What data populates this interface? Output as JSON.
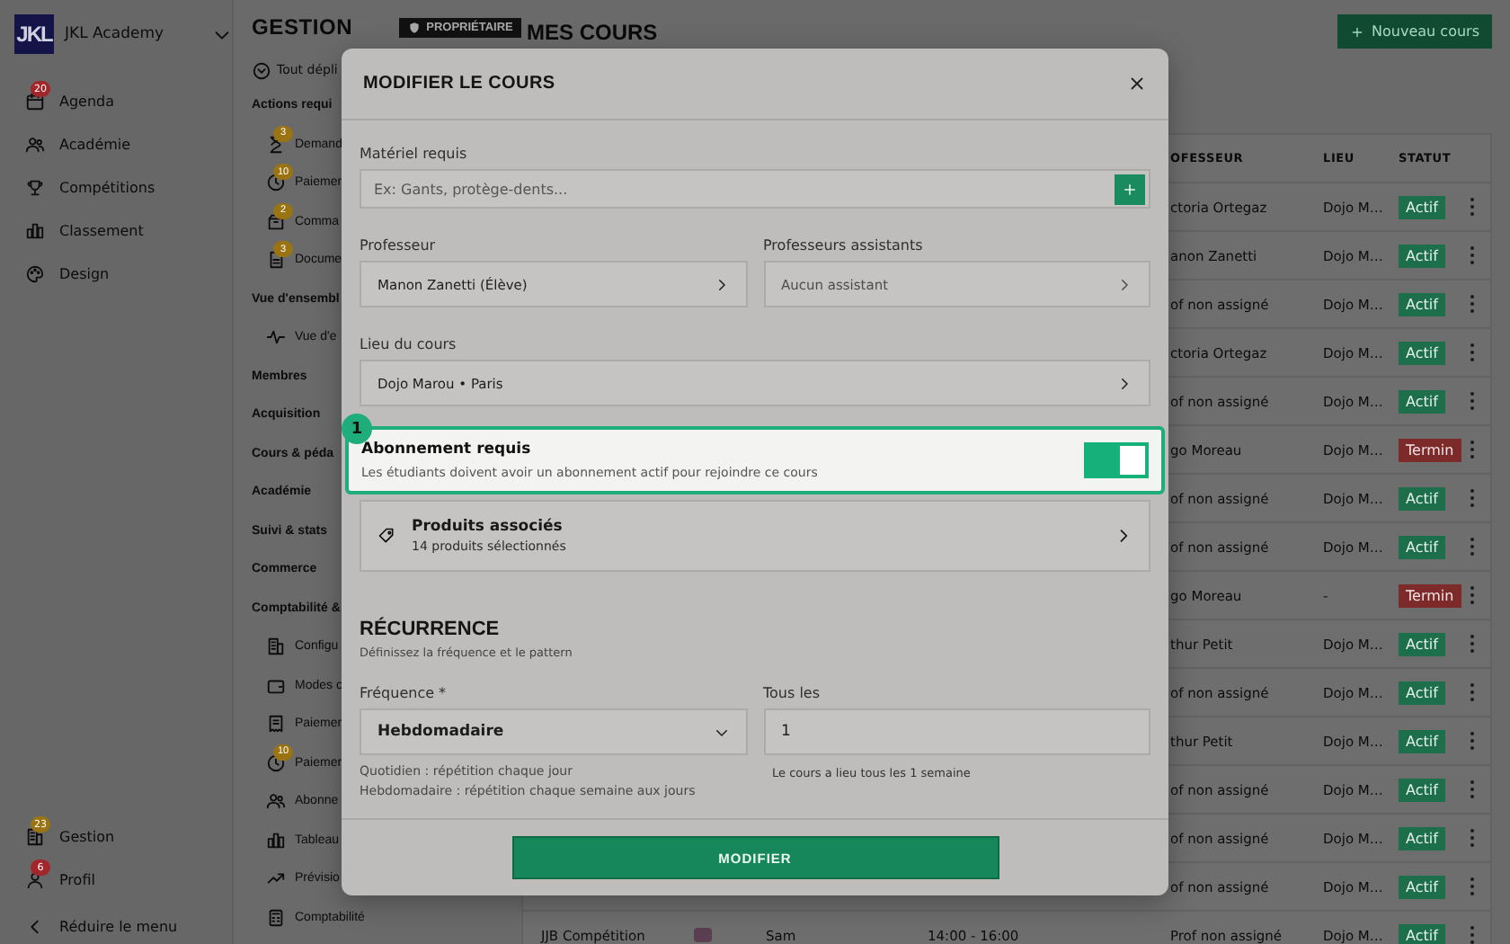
{
  "sidebar": {
    "brand": {
      "logo": "JKL",
      "name": "JKL Academy"
    },
    "items": [
      {
        "label": "Agenda",
        "badge": {
          "text": "20",
          "color": "#a3262b"
        }
      },
      {
        "label": "Académie"
      },
      {
        "label": "Compétitions"
      },
      {
        "label": "Classement"
      },
      {
        "label": "Design"
      }
    ],
    "bottom_items": [
      {
        "label": "Gestion",
        "badge": {
          "text": "23",
          "color": "#9a7312"
        }
      },
      {
        "label": "Profil",
        "badge": {
          "text": "6",
          "color": "#a3262b"
        }
      }
    ],
    "collapse": "Réduire le menu"
  },
  "subnav": {
    "title": "GESTION",
    "role_badge": "PROPRIÉTAIRE",
    "expand_all": "Tout dépli",
    "entries": [
      {
        "kind": "section",
        "label": "Actions requi"
      },
      {
        "kind": "item",
        "label": "Demand",
        "badge": "3"
      },
      {
        "kind": "item",
        "label": "Paiemer",
        "badge": "10"
      },
      {
        "kind": "item",
        "label": "Comma",
        "badge": "2"
      },
      {
        "kind": "item",
        "label": "Docume",
        "badge": "3"
      },
      {
        "kind": "section",
        "label": "Vue d'ensembl"
      },
      {
        "kind": "item",
        "label": "Vue d'e"
      },
      {
        "kind": "section",
        "label": "Membres"
      },
      {
        "kind": "section",
        "label": "Acquisition"
      },
      {
        "kind": "section",
        "label": "Cours & péda"
      },
      {
        "kind": "section",
        "label": "Académie"
      },
      {
        "kind": "section",
        "label": "Suivi & stats"
      },
      {
        "kind": "section",
        "label": "Commerce"
      },
      {
        "kind": "section",
        "label": "Comptabilité &"
      },
      {
        "kind": "item",
        "label": "Configu"
      },
      {
        "kind": "item",
        "label": "Modes c"
      },
      {
        "kind": "item",
        "label": "Paiemer"
      },
      {
        "kind": "item",
        "label": "Paiemer",
        "badge": "10"
      },
      {
        "kind": "item",
        "label": "Abonne"
      },
      {
        "kind": "item",
        "label": "Tableau"
      },
      {
        "kind": "item",
        "label": "Prévisio"
      },
      {
        "kind": "item",
        "label": "Comptabilité"
      }
    ]
  },
  "main": {
    "title": "MES COURS",
    "new_button": "Nouveau cours",
    "table": {
      "columns": [
        "OFESSEUR",
        "LIEU",
        "STATUT"
      ],
      "rows": [
        {
          "professor": "ctoria Ortegaz",
          "location": "Dojo M…",
          "status": {
            "label": "Actif",
            "color": "#1d6e4b"
          }
        },
        {
          "professor": "anon Zanetti",
          "location": "Dojo M…",
          "status": {
            "label": "Actif",
            "color": "#1d6e4b"
          }
        },
        {
          "professor": "of non assigné",
          "location": "Dojo M…",
          "status": {
            "label": "Actif",
            "color": "#1d6e4b"
          }
        },
        {
          "professor": "ctoria Ortegaz",
          "location": "Dojo M…",
          "status": {
            "label": "Actif",
            "color": "#1d6e4b"
          }
        },
        {
          "professor": "of non assigné",
          "location": "Dojo M…",
          "status": {
            "label": "Actif",
            "color": "#1d6e4b"
          }
        },
        {
          "professor": "go Moreau",
          "location": "Dojo M…",
          "status": {
            "label": "Termin",
            "color": "#7c2a2a"
          }
        },
        {
          "professor": "of non assigné",
          "location": "Dojo M…",
          "status": {
            "label": "Actif",
            "color": "#1d6e4b"
          }
        },
        {
          "professor": "of non assigné",
          "location": "Dojo M…",
          "status": {
            "label": "Actif",
            "color": "#1d6e4b"
          }
        },
        {
          "professor": "go Moreau",
          "location": "-",
          "status": {
            "label": "Termin",
            "color": "#7c2a2a"
          }
        },
        {
          "professor": "thur Petit",
          "location": "Dojo M…",
          "status": {
            "label": "Actif",
            "color": "#1d6e4b"
          }
        },
        {
          "professor": "of non assigné",
          "location": "Dojo M…",
          "status": {
            "label": "Actif",
            "color": "#1d6e4b"
          }
        },
        {
          "professor": "thur Petit",
          "location": "Dojo M…",
          "status": {
            "label": "Actif",
            "color": "#1d6e4b"
          }
        },
        {
          "professor": "of non assigné",
          "location": "Dojo M…",
          "status": {
            "label": "Actif",
            "color": "#1d6e4b"
          }
        },
        {
          "professor": "of non assigné",
          "location": "Dojo M…",
          "status": {
            "label": "Actif",
            "color": "#1d6e4b"
          }
        },
        {
          "professor": "of non assigné",
          "location": "Dojo M…",
          "status": {
            "label": "Actif",
            "color": "#1d6e4b"
          }
        },
        {
          "course": "JJB Compétition",
          "day": "Sam",
          "time": "14:00 - 16:00",
          "professor": "Prof non assigné",
          "location": "Dojo M…",
          "status": {
            "label": "Actif",
            "color": "#1d6e4b"
          }
        }
      ]
    }
  },
  "modal": {
    "title": "MODIFIER LE COURS",
    "equipment": {
      "label": "Matériel requis",
      "placeholder": "Ex: Gants, protège-dents..."
    },
    "teacher": {
      "label": "Professeur",
      "value": "Manon Zanetti (Élève)"
    },
    "assistants": {
      "label": "Professeurs assistants",
      "placeholder": "Aucun assistant"
    },
    "location": {
      "label": "Lieu du cours",
      "value": "Dojo Marou • Paris"
    },
    "subscription": {
      "step": "1",
      "title": "Abonnement requis",
      "description": "Les étudiants doivent avoir un abonnement actif pour rejoindre ce cours",
      "on": true
    },
    "products": {
      "title": "Produits associés",
      "subtitle": "14 produits sélectionnés"
    },
    "recurrence": {
      "title": "RÉCURRENCE",
      "subtitle": "Définissez la fréquence et le pattern",
      "frequency": {
        "label": "Fréquence *",
        "value": "Hebdomadaire",
        "help": [
          "Quotidien : répétition chaque jour",
          "Hebdomadaire : répétition chaque semaine aux jours"
        ]
      },
      "interval": {
        "label": "Tous les",
        "value": "1",
        "hint": "Le cours a lieu tous les 1 semaine"
      }
    },
    "submit": "MODIFIER"
  }
}
